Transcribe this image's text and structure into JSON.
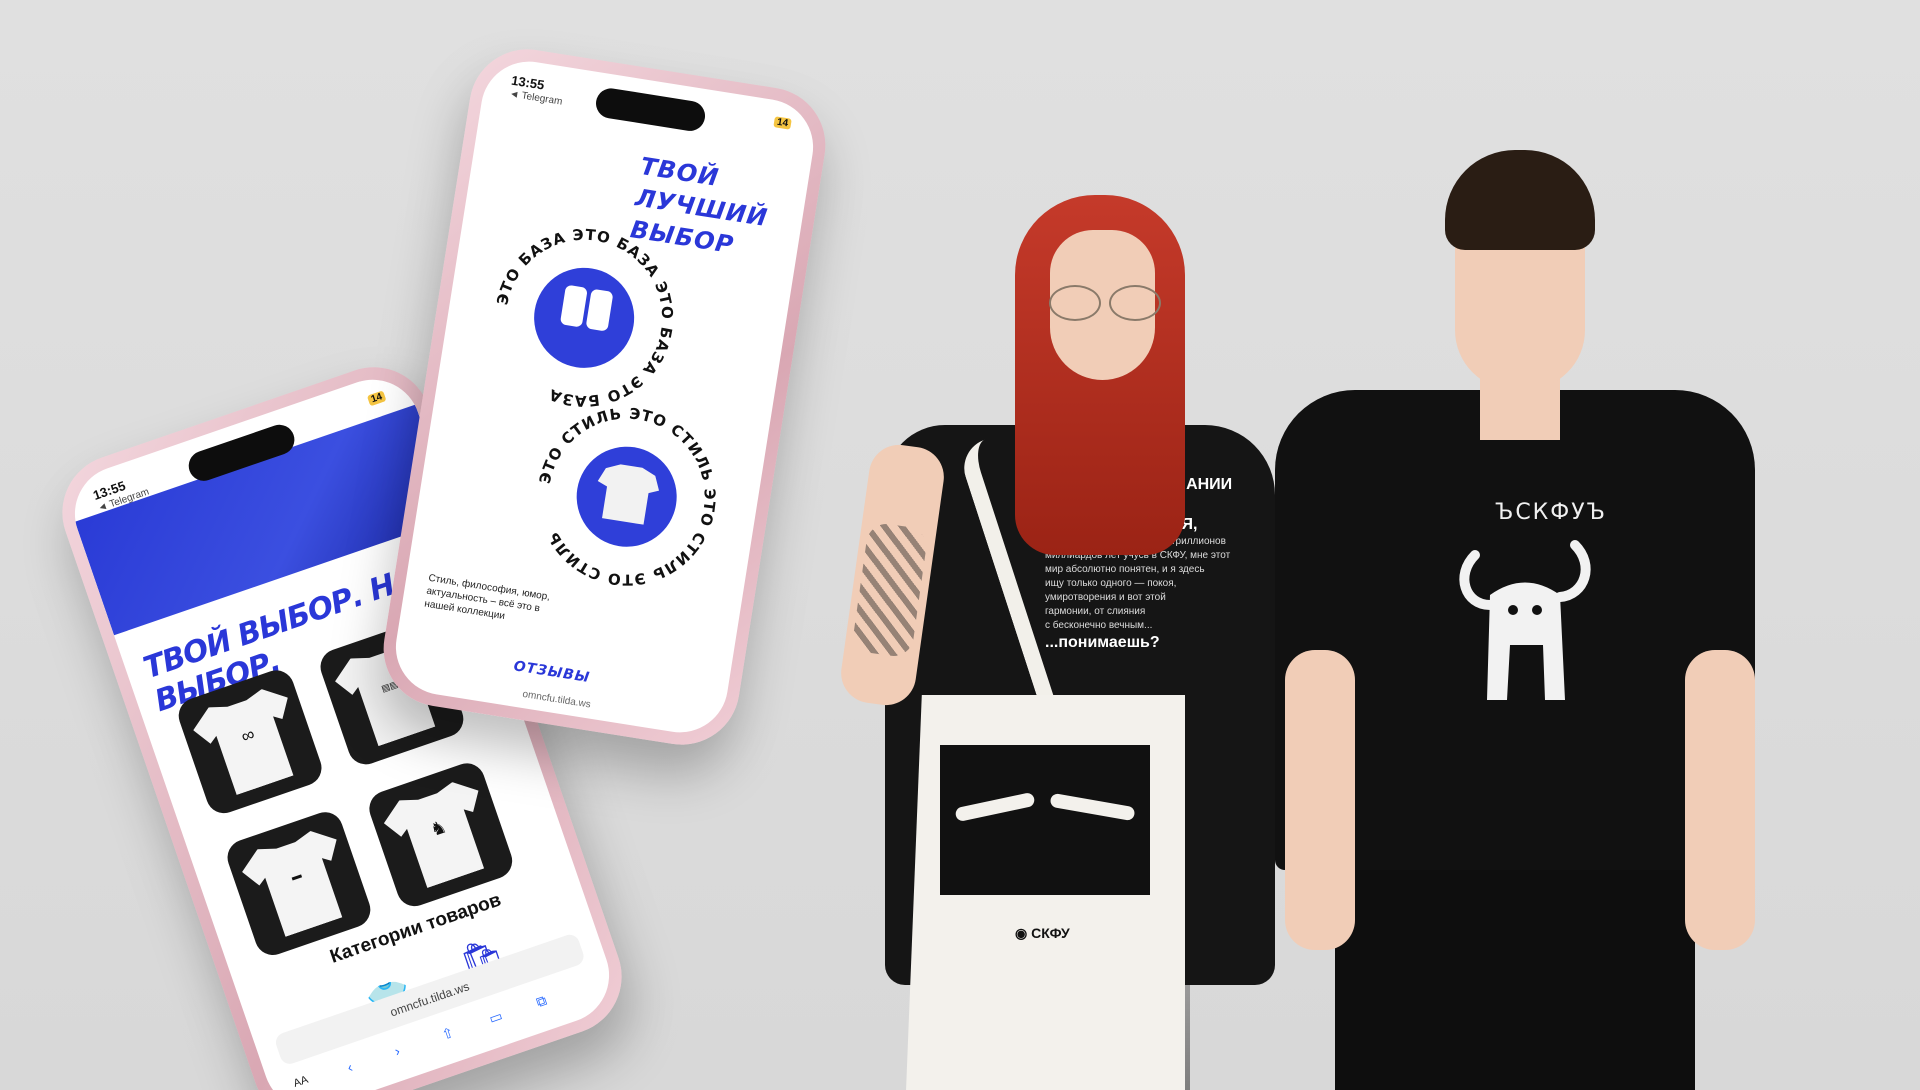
{
  "phone_left": {
    "time": "13:55",
    "back_label": "◄ Telegram",
    "battery": "14",
    "headline": "ТВОЙ ВЫБОР. НАШ ВЫБОР.",
    "categories_title": "Категории товаров",
    "url": "omncfu.tilda.ws",
    "text_size_button": "AA",
    "category_icons": [
      "tshirt-icon",
      "bag-icon"
    ]
  },
  "phone_right": {
    "time": "13:55",
    "back_label": "◄ Telegram",
    "battery": "14",
    "headline": "ТВОЙ ЛУЧШИЙ ВЫБОР",
    "badge_base_text": "ЭТО БАЗА ЭТО БАЗА ЭТО БАЗА ЭТО БАЗА ",
    "badge_style_text": "ЭТО СТИЛЬ ЭТО СТИЛЬ ЭТО СТИЛЬ ЭТО СТИЛЬ ",
    "description": "Стиль, философия, юмор, актуальность – всё это в нашей коллекции",
    "reviews_label": "ОТЗЫВЫ",
    "url": "omncfu.tilda.ws"
  },
  "girl": {
    "shirt_text_lines": [
      "Я В СВОЕМ ПОЗНАНИИ",
      "НАСТОЛЬКО ПРЕИСПОЛНИЛСЯ,",
      "что я как будто бы уже сто триллионов",
      "миллиардов лет учусь в СКФУ, мне этот",
      "мир абсолютно понятен, и я здесь",
      "ищу только одного — покоя,",
      "умиротворения и вот этой",
      "гармонии, от слияния",
      "с бесконечно вечным...",
      "...понимаешь?"
    ],
    "tote_logo": "СКФУ"
  },
  "guy": {
    "shirt_label": "ЪСКФУЪ"
  }
}
